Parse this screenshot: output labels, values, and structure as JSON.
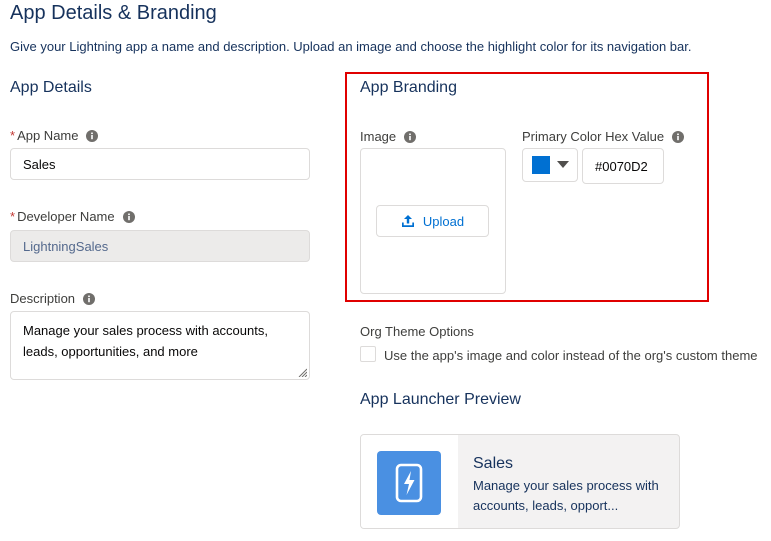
{
  "header": {
    "title": "App Details & Branding",
    "intro": "Give your Lightning app a name and description. Upload an image and choose the highlight color for its navigation bar."
  },
  "app_details": {
    "section_title": "App Details",
    "required_marker": "*",
    "app_name": {
      "label": "App Name",
      "value": "Sales"
    },
    "developer_name": {
      "label": "Developer Name",
      "value": "LightningSales"
    },
    "description": {
      "label": "Description",
      "value": "Manage your sales process with accounts, leads, opportunities, and more"
    }
  },
  "app_branding": {
    "section_title": "App Branding",
    "image_label": "Image",
    "upload_label": "Upload",
    "primary_color_label": "Primary Color Hex Value",
    "primary_color_hex": "#0070D2",
    "swatch_color": "#0070D2"
  },
  "org_theme": {
    "label": "Org Theme Options",
    "checkbox_label": "Use the app's image and color instead of the org's custom theme",
    "checked": false
  },
  "launcher_preview": {
    "section_title": "App Launcher Preview",
    "app_name": "Sales",
    "description": "Manage your sales process with accounts, leads, opport...",
    "tile_color": "#4a90e2",
    "tile_icon": "lightning-phone-icon"
  },
  "colors": {
    "accent": "#0070d2",
    "title": "#16325c",
    "required": "#c23934",
    "highlight_border": "#e00000"
  }
}
